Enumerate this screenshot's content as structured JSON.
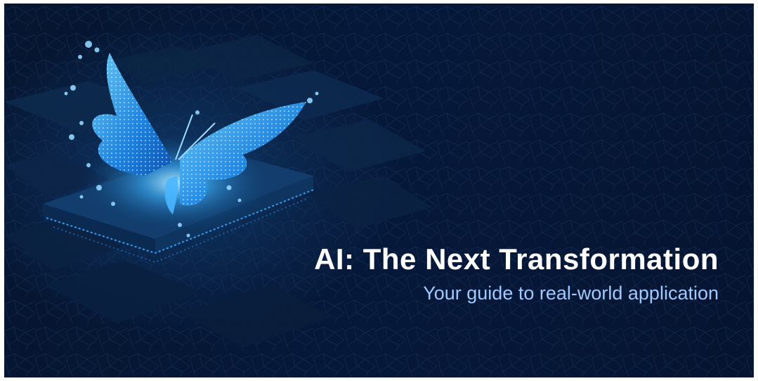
{
  "banner": {
    "title": "AI: The Next Transformation",
    "subtitle": "Your guide to real-world application",
    "image": "glowing-butterfly-over-microchip-illustration"
  },
  "colors": {
    "background": "#061630",
    "accent": "#4fb6ff",
    "title": "#ffffff",
    "subtitle": "#9ecbff"
  }
}
